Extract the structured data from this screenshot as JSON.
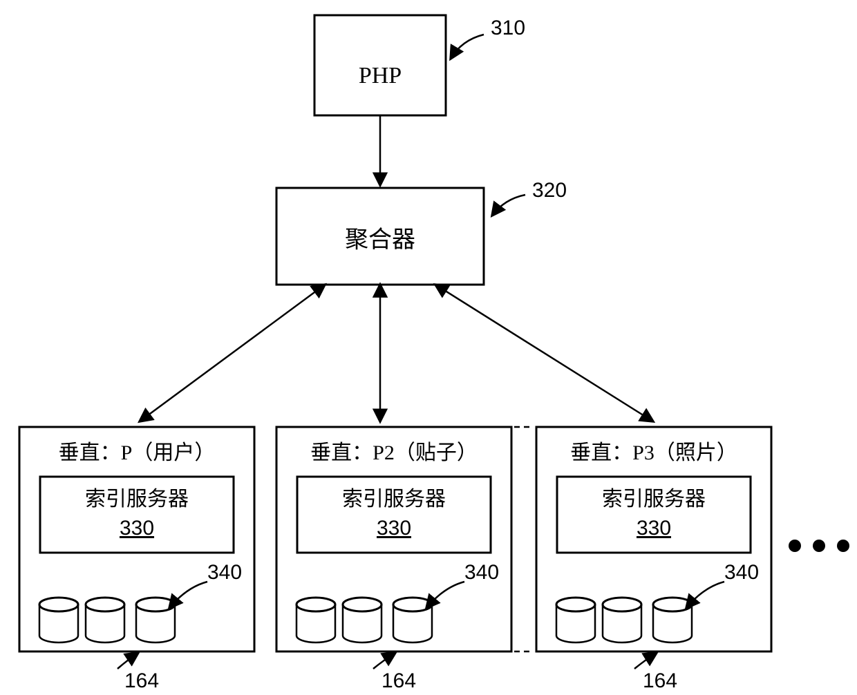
{
  "diagram": {
    "php_label": "PHP",
    "aggregator_label": "聚合器",
    "verticals": [
      {
        "title": "垂直：P（用户）"
      },
      {
        "title": "垂直：P2（贴子）"
      },
      {
        "title": "垂直：P3（照片）"
      }
    ],
    "index_server_label": "索引服务器",
    "index_server_number": "330",
    "refs": {
      "php": "310",
      "aggregator": "320",
      "index_partition": "340",
      "vertical": "164"
    },
    "ellipsis": "•••"
  }
}
